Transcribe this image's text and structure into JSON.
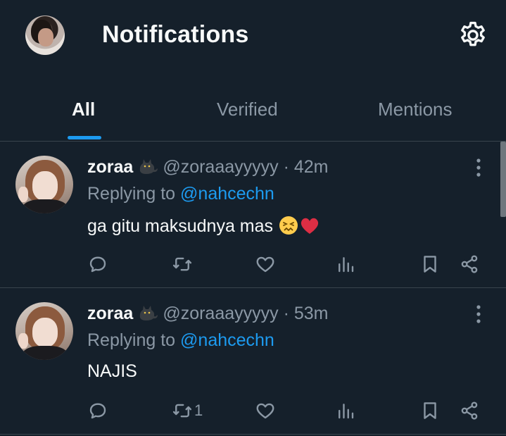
{
  "header": {
    "title": "Notifications",
    "avatar_icon": "user-avatar",
    "settings_icon": "gear-icon"
  },
  "tabs": [
    {
      "label": "All",
      "active": true
    },
    {
      "label": "Verified",
      "active": false
    },
    {
      "label": "Mentions",
      "active": false
    }
  ],
  "tweets": [
    {
      "name": "zoraa",
      "name_emoji": "black-cat",
      "handle": "@zoraaayyyyy",
      "separator": "·",
      "time": "42m",
      "replying_prefix": "Replying to",
      "replying_to": "@nahcechn",
      "text": "ga gitu maksudnya mas",
      "emojis": [
        "confounded-face",
        "red-heart"
      ],
      "retweet_count": ""
    },
    {
      "name": "zoraa",
      "name_emoji": "black-cat",
      "handle": "@zoraaayyyyy",
      "separator": "·",
      "time": "53m",
      "replying_prefix": "Replying to",
      "replying_to": "@nahcechn",
      "text": "NAJIS",
      "emojis": [],
      "retweet_count": "1"
    }
  ],
  "colors": {
    "background": "#15202b",
    "accent": "#1d9bf0",
    "muted": "#8b98a5",
    "text": "#f7f9f9",
    "divider": "#38444d"
  }
}
